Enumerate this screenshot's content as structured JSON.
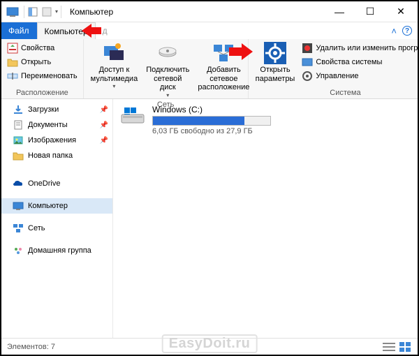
{
  "window": {
    "title": "Компьютер"
  },
  "tabs": {
    "file": "Файл",
    "computer": "Компьютер",
    "hidden_suffix": "д"
  },
  "ribbon": {
    "location": {
      "label": "Расположение",
      "properties": "Свойства",
      "open": "Открыть",
      "rename": "Переименовать"
    },
    "network": {
      "label": "Сеть",
      "media": "Доступ к\nмультимедиа",
      "map_drive": "Подключить\nсетевой диск",
      "add_location": "Добавить сетевое\nрасположение"
    },
    "system": {
      "label": "Система",
      "settings": "Открыть\nпараметры",
      "uninstall": "Удалить или изменить программу",
      "sys_props": "Свойства системы",
      "manage": "Управление"
    }
  },
  "nav": {
    "downloads": "Загрузки",
    "documents": "Документы",
    "pictures": "Изображения",
    "new_folder": "Новая папка",
    "onedrive": "OneDrive",
    "computer": "Компьютер",
    "network": "Сеть",
    "homegroup": "Домашняя группа"
  },
  "drive": {
    "name": "Windows (C:)",
    "free_text": "6,03 ГБ свободно из 27,9 ГБ",
    "fill_percent": 78
  },
  "status": {
    "elements": "Элементов: 7"
  },
  "watermark": "EasyDoit.ru"
}
